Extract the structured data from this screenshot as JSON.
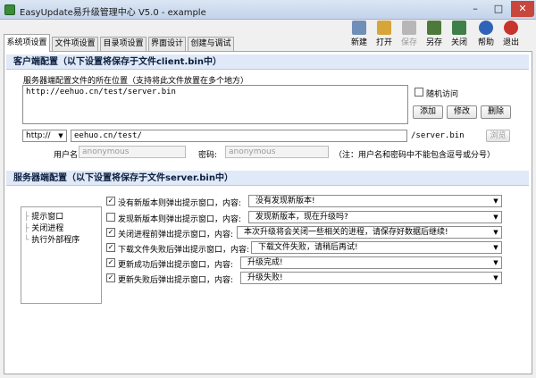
{
  "window": {
    "title": "EasyUpdate易升级管理中心 V5.0 - example",
    "min": "–",
    "max": "□",
    "close": "✕"
  },
  "tabs": [
    {
      "label": "系统项设置",
      "active": true
    },
    {
      "label": "文件项设置"
    },
    {
      "label": "目录项设置"
    },
    {
      "label": "界面设计"
    },
    {
      "label": "创建与调试"
    }
  ],
  "toolbar": [
    {
      "label": "新建",
      "icon": "new-file-icon",
      "color": "#6f8fb8"
    },
    {
      "label": "打开",
      "icon": "open-folder-icon",
      "color": "#d6a63a"
    },
    {
      "label": "保存",
      "icon": "save-icon",
      "color": "#b7b7b7",
      "disabled": true
    },
    {
      "label": "另存",
      "icon": "save-as-icon",
      "color": "#4d7a3a"
    },
    {
      "label": "关闭",
      "icon": "close-file-icon",
      "color": "#3f7f4a"
    },
    {
      "label": "帮助",
      "icon": "help-icon",
      "color": "#2f63b8"
    },
    {
      "label": "退出",
      "icon": "exit-icon",
      "color": "#c8332e"
    }
  ],
  "client": {
    "heading": "客户端配置（以下设置将保存于文件client.bin中）",
    "url_list_label": "服务器端配置文件的所在位置（支持将此文件放置在多个地方）",
    "url_list_items": [
      "http://eehuo.cn/test/server.bin"
    ],
    "random_label": "随机访问",
    "add": "添加",
    "modify": "修改",
    "delete": "删除",
    "protocol": "http://",
    "host": "eehuo.cn/test/",
    "suffix": "/server.bin",
    "browse": "浏览",
    "user_label": "用户名:",
    "user_value": "anonymous",
    "pass_label": "密码:",
    "pass_value": "anonymous",
    "note": "（注：用户名和密码中不能包含逗号或分号）"
  },
  "server": {
    "heading": "服务器端配置（以下设置将保存于文件server.bin中）",
    "tree": [
      "提示窗口",
      "关闭进程",
      "执行外部程序"
    ],
    "rows": [
      {
        "label": "没有新版本则弹出提示窗口，内容:",
        "checked": true,
        "value": "没有发现新版本!"
      },
      {
        "label": "发现新版本则弹出提示窗口，内容:",
        "checked": false,
        "value": "发现新版本，现在升级吗?"
      },
      {
        "label": "关闭进程前弹出提示窗口，内容:",
        "checked": true,
        "value": "本次升级将会关闭一些相关的进程，请保存好数据后继续!"
      },
      {
        "label": "下载文件失败后弹出提示窗口，内容:",
        "checked": true,
        "value": "下载文件失败，请稍后再试!"
      },
      {
        "label": "更新成功后弹出提示窗口，内容:",
        "checked": true,
        "value": "升级完成!"
      },
      {
        "label": "更新失败后弹出提示窗口，内容:",
        "checked": true,
        "value": "升级失败!"
      }
    ]
  }
}
